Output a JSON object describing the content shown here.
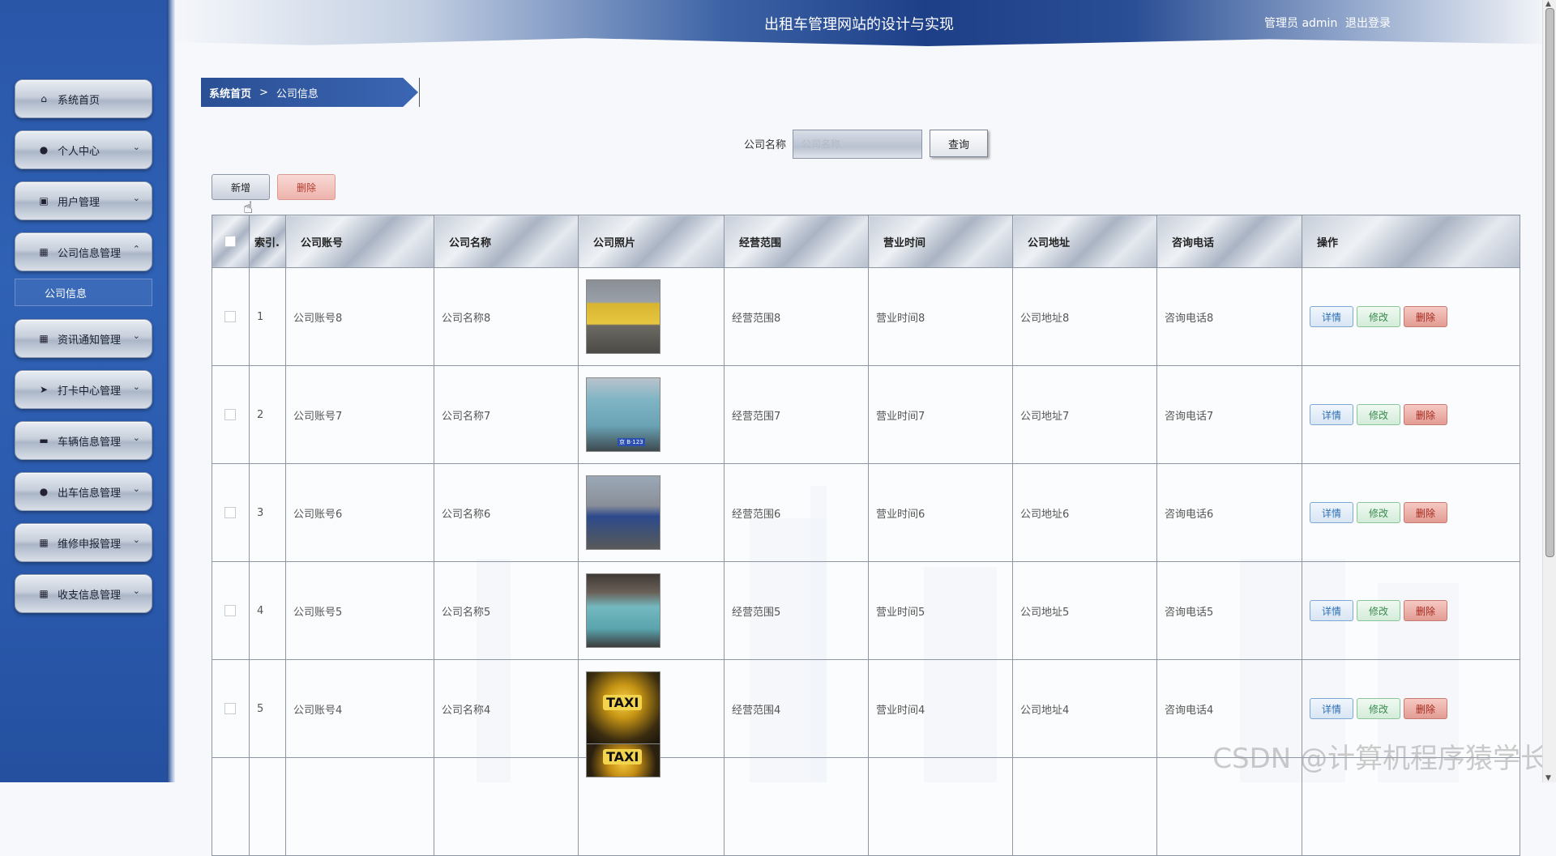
{
  "header": {
    "title": "出租车管理网站的设计与实现",
    "user": "管理员 admin",
    "logout": "退出登录"
  },
  "sidebar": {
    "items": [
      {
        "label": "系统首页",
        "icon": "home-icon",
        "glyph": "⌂",
        "chevron": ""
      },
      {
        "label": "个人中心",
        "icon": "user-icon",
        "glyph": "●",
        "chevron": "⌄"
      },
      {
        "label": "用户管理",
        "icon": "id-card-icon",
        "glyph": "▣",
        "chevron": "⌄"
      },
      {
        "label": "公司信息管理",
        "icon": "grid-icon",
        "glyph": "▦",
        "chevron": "⌃"
      },
      {
        "label": "资讯通知管理",
        "icon": "grid-icon",
        "glyph": "▦",
        "chevron": "⌄"
      },
      {
        "label": "打卡中心管理",
        "icon": "send-icon",
        "glyph": "➤",
        "chevron": "⌄"
      },
      {
        "label": "车辆信息管理",
        "icon": "car-icon",
        "glyph": "▬",
        "chevron": "⌄"
      },
      {
        "label": "出车信息管理",
        "icon": "user-icon",
        "glyph": "●",
        "chevron": "⌄"
      },
      {
        "label": "维修申报管理",
        "icon": "grid-icon",
        "glyph": "▦",
        "chevron": "⌄"
      },
      {
        "label": "收支信息管理",
        "icon": "grid-icon",
        "glyph": "▦",
        "chevron": "⌄"
      }
    ],
    "submenu": {
      "label": "公司信息"
    }
  },
  "breadcrumb": {
    "home": "系统首页",
    "separator": ">",
    "current": "公司信息"
  },
  "search": {
    "label": "公司名称",
    "placeholder": "公司名称",
    "value": "",
    "button": "查询"
  },
  "toolbar": {
    "add": "新增",
    "delete": "删除"
  },
  "table": {
    "headers": [
      "",
      "索引.",
      "公司账号",
      "公司名称",
      "公司照片",
      "经营范围",
      "营业时间",
      "公司地址",
      "咨询电话",
      "操作"
    ],
    "rows": [
      {
        "index": "1",
        "account": "公司账号8",
        "name": "公司名称8",
        "scope": "经营范围8",
        "hours": "营业时间8",
        "address": "公司地址8",
        "phone": "咨询电话8"
      },
      {
        "index": "2",
        "account": "公司账号7",
        "name": "公司名称7",
        "scope": "经营范围7",
        "hours": "营业时间7",
        "address": "公司地址7",
        "phone": "咨询电话7"
      },
      {
        "index": "3",
        "account": "公司账号6",
        "name": "公司名称6",
        "scope": "经营范围6",
        "hours": "营业时间6",
        "address": "公司地址6",
        "phone": "咨询电话6"
      },
      {
        "index": "4",
        "account": "公司账号5",
        "name": "公司名称5",
        "scope": "经营范围5",
        "hours": "营业时间5",
        "address": "公司地址5",
        "phone": "咨询电话5"
      },
      {
        "index": "5",
        "account": "公司账号4",
        "name": "公司名称4",
        "scope": "经营范围4",
        "hours": "营业时间4",
        "address": "公司地址4",
        "phone": "咨询电话4"
      },
      {
        "index": "",
        "account": "",
        "name": "",
        "scope": "",
        "hours": "",
        "address": "",
        "phone": ""
      }
    ],
    "actions": {
      "detail": "详情",
      "edit": "修改",
      "delete": "删除"
    },
    "photo_text": {
      "taxi_sign": "TAXI",
      "plate": "京 B·123"
    }
  },
  "watermark": "CSDN @计算机程序猿学长"
}
